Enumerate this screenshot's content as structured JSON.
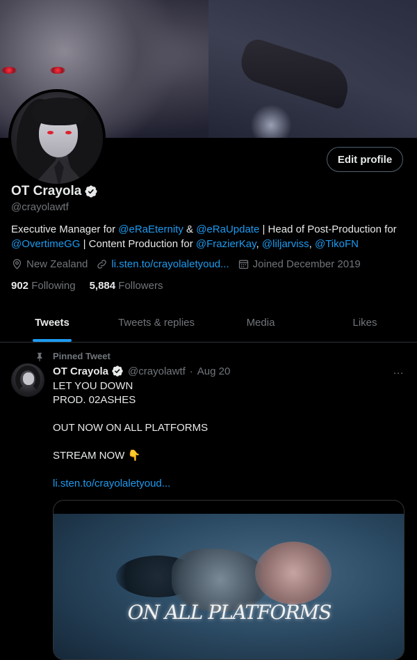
{
  "profile": {
    "display_name": "OT Crayola",
    "handle": "@crayolawtf",
    "edit_label": "Edit profile",
    "bio": {
      "t1": "Executive Manager for ",
      "m1": "@eRaEternity",
      "t2": " & ",
      "m2": "@eRaUpdate",
      "t3": " | Head of Post-Production for ",
      "m3": "@OvertimeGG",
      "t4": " | Content Production for ",
      "m4": "@FrazierKay",
      "t5": ", ",
      "m5": "@liljarviss",
      "t6": ", ",
      "m6": "@TikoFN"
    },
    "location": "New Zealand",
    "website": "li.sten.to/crayolaletyoud...",
    "joined": "Joined December 2019",
    "following_count": "902",
    "following_label": "Following",
    "followers_count": "5,884",
    "followers_label": "Followers"
  },
  "tabs": [
    {
      "label": "Tweets",
      "active": true
    },
    {
      "label": "Tweets & replies",
      "active": false
    },
    {
      "label": "Media",
      "active": false
    },
    {
      "label": "Likes",
      "active": false
    }
  ],
  "tweet": {
    "pinned_label": "Pinned Tweet",
    "author": "OT Crayola",
    "handle": "@crayolawtf",
    "separator": "·",
    "date": "Aug 20",
    "more_icon": "…",
    "lines": [
      "LET YOU DOWN",
      "PROD. 02ASHES",
      "",
      "OUT NOW ON ALL PLATFORMS",
      "",
      "STREAM NOW 👇",
      ""
    ],
    "link": "li.sten.to/crayolaletyoud...",
    "media_caption": "ON ALL PLATFORMS"
  },
  "colors": {
    "accent": "#1d9bf0",
    "text_primary": "#e7e9ea",
    "text_secondary": "#71767b",
    "border": "#2f3336"
  }
}
